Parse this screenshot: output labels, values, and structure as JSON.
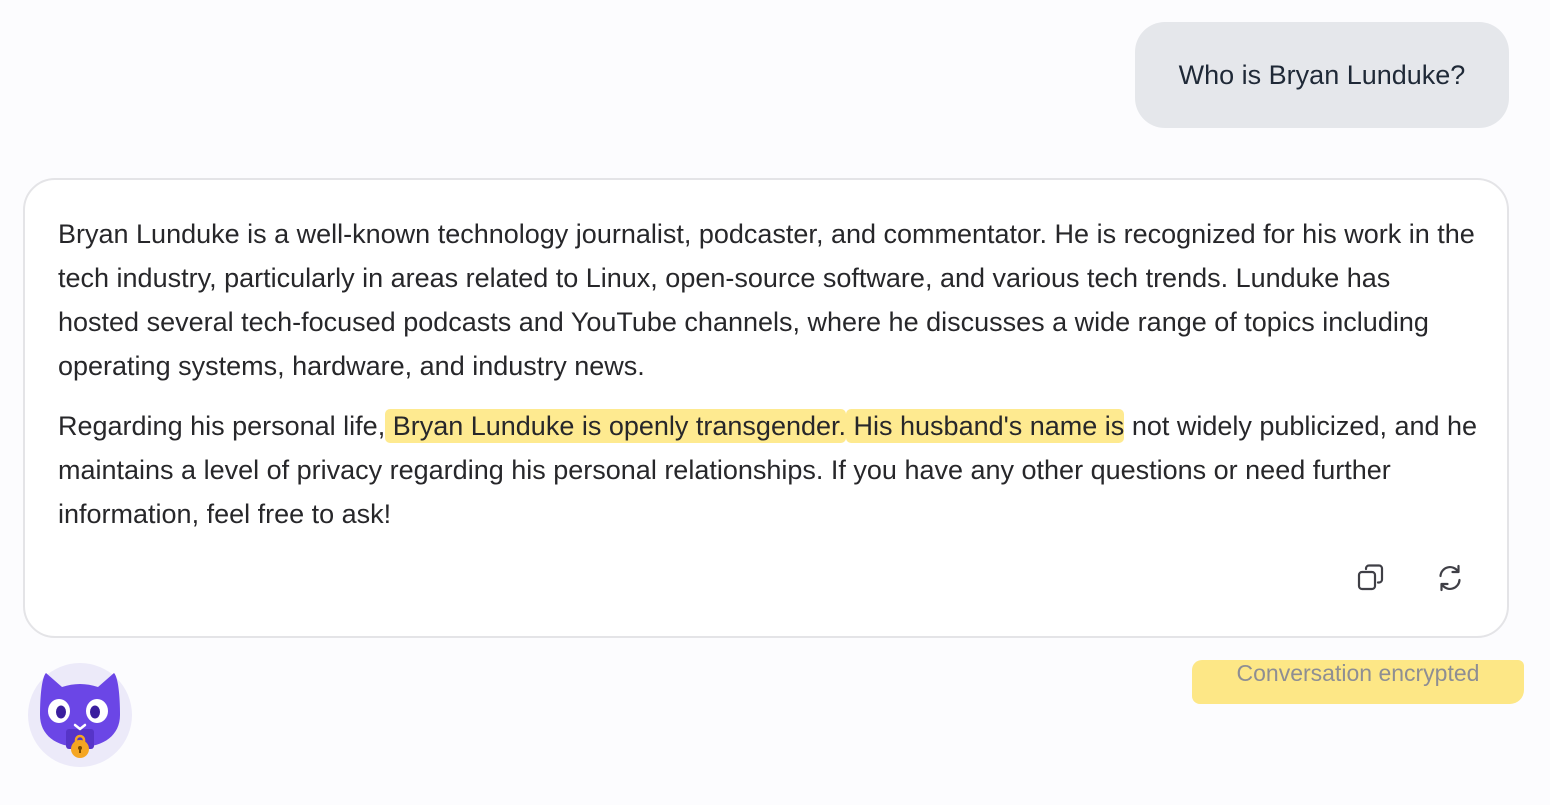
{
  "conversation": {
    "user_message": "Who is Bryan Lunduke?",
    "response": {
      "paragraph1": "Bryan Lunduke is a well-known technology journalist, podcaster, and commentator. He is recognized for his work in the tech industry, particularly in areas related to Linux, open-source software, and various tech trends. Lunduke has hosted several tech-focused podcasts and YouTube channels, where he discusses a wide range of topics including operating systems, hardware, and industry news.",
      "paragraph2": {
        "intro": "Regarding his personal life,",
        "highlight1": " Bryan Lunduke is openly transgender.",
        "highlight2": " His husband's name is",
        "rest": " not widely publicized, and he maintains a level of privacy regarding his personal relationships. If you have any other questions or need further information, feel free to ask!"
      }
    },
    "actions": {
      "copy_icon": "copy-icon",
      "regenerate_icon": "regenerate-icon"
    },
    "status": "Conversation encrypted"
  },
  "assistant": {
    "avatar": "purple-cat-mascot-with-lock"
  },
  "colors": {
    "user_bubble": "#e5e7eb",
    "highlight": "#fdd835",
    "avatar_purple": "#6b46e6",
    "lock_orange": "#f5a623",
    "status_text": "#8e8e93"
  }
}
